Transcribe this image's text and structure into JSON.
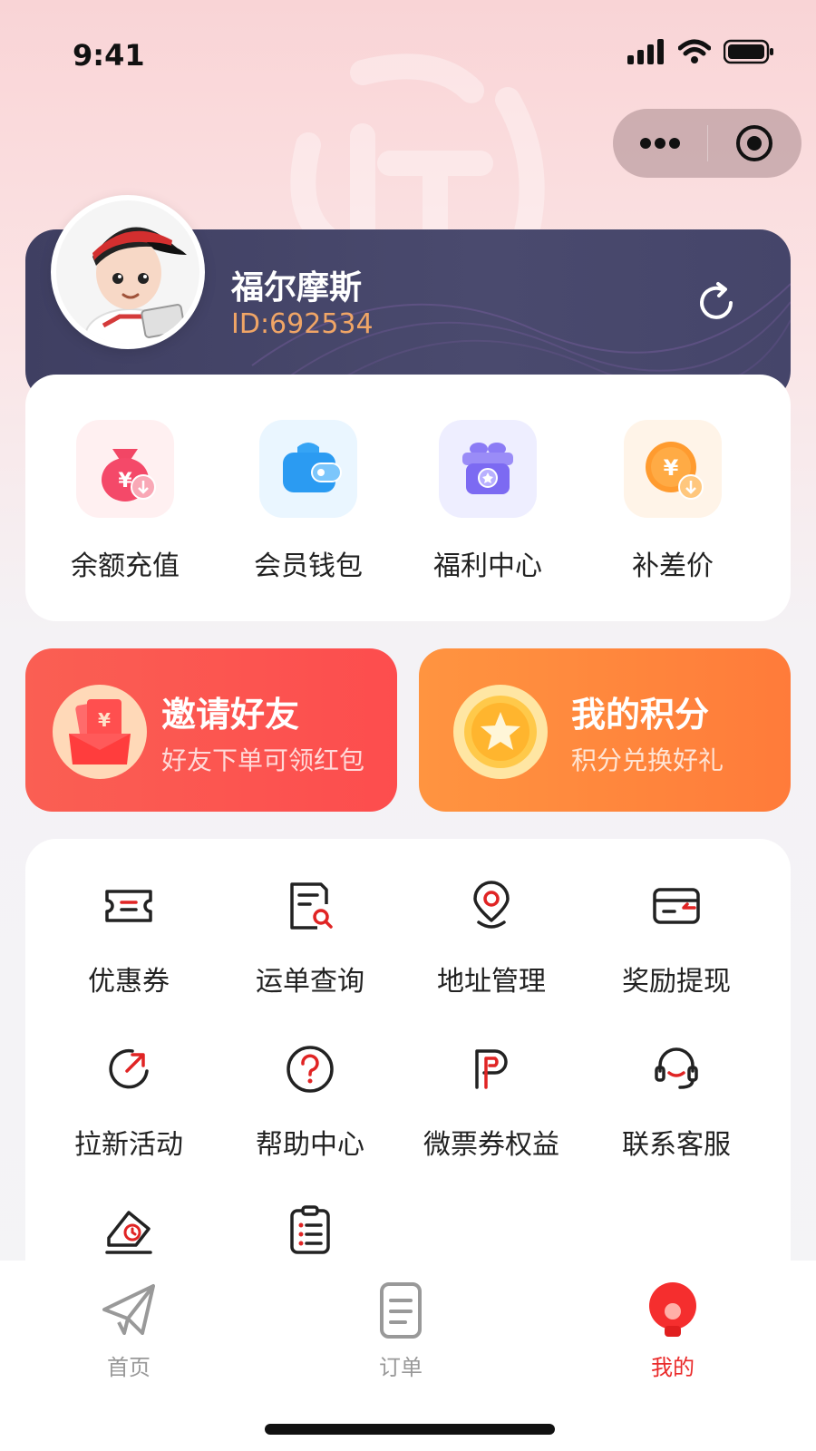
{
  "status_bar": {
    "time": "9:41"
  },
  "profile": {
    "name": "福尔摩斯",
    "id_text": "ID:692534"
  },
  "wallet": [
    {
      "label": "余额充值",
      "icon": "money-bag-icon"
    },
    {
      "label": "会员钱包",
      "icon": "wallet-icon"
    },
    {
      "label": "福利中心",
      "icon": "gift-icon"
    },
    {
      "label": "补差价",
      "icon": "yuan-coin-icon"
    }
  ],
  "promos": {
    "invite": {
      "title": "邀请好友",
      "subtitle": "好友下单可领红包",
      "icon": "red-envelope-icon"
    },
    "points": {
      "title": "我的积分",
      "subtitle": "积分兑换好礼",
      "icon": "star-coin-icon"
    }
  },
  "services": [
    {
      "label": "优惠券",
      "icon": "coupon-icon"
    },
    {
      "label": "运单查询",
      "icon": "waybill-search-icon"
    },
    {
      "label": "地址管理",
      "icon": "location-pin-icon"
    },
    {
      "label": "奖励提现",
      "icon": "card-withdraw-icon"
    },
    {
      "label": "拉新活动",
      "icon": "refresh-arrow-icon"
    },
    {
      "label": "帮助中心",
      "icon": "question-icon"
    },
    {
      "label": "微票券权益",
      "icon": "p-letter-icon"
    },
    {
      "label": "联系客服",
      "icon": "headset-icon"
    }
  ],
  "tabs": [
    {
      "label": "首页",
      "icon": "paper-plane-icon",
      "active": false
    },
    {
      "label": "订单",
      "icon": "document-icon",
      "active": false
    },
    {
      "label": "我的",
      "icon": "profile-bulb-icon",
      "active": true
    }
  ],
  "colors": {
    "accent": "#ea2a2a",
    "profile_card": "#43436a",
    "invite_banner": "#fd5651",
    "points_banner": "#ff8a3d",
    "id_text": "#f0a566"
  }
}
